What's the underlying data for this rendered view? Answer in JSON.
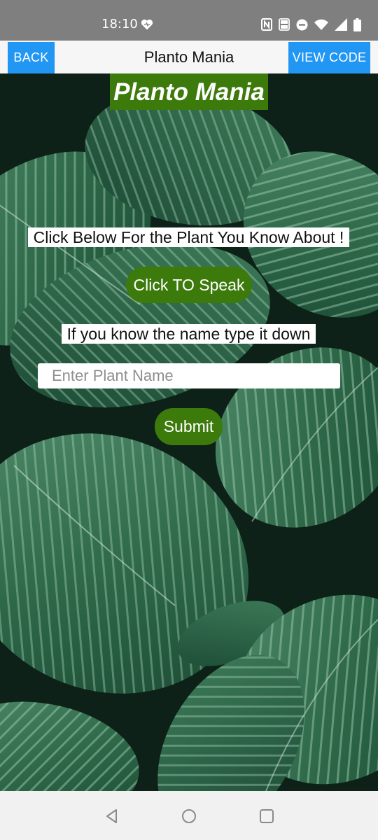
{
  "status_bar": {
    "time": "18:10",
    "icons": [
      "heart-icon",
      "nfc-icon",
      "volte-icon",
      "dnd-icon",
      "wifi-icon",
      "signal-icon",
      "battery-icon"
    ]
  },
  "app_bar": {
    "title": "Planto Mania",
    "back_label": "BACK",
    "view_code_label": "VIEW CODE",
    "accent_color": "#2196f3"
  },
  "main": {
    "brand_title": "Planto Mania",
    "voice_prompt": "Click Below For the Plant You Know About !",
    "speak_button_label": "Click TO Speak",
    "type_prompt": "If you know the name type it down",
    "plant_name_input": {
      "value": "",
      "placeholder": "Enter Plant Name"
    },
    "submit_label": "Submit",
    "button_color": "#3c7a0c",
    "background": "tropical-leaves-photo"
  },
  "nav_bar": {
    "buttons": [
      "back-triangle-icon",
      "home-circle-icon",
      "recents-square-icon"
    ]
  }
}
